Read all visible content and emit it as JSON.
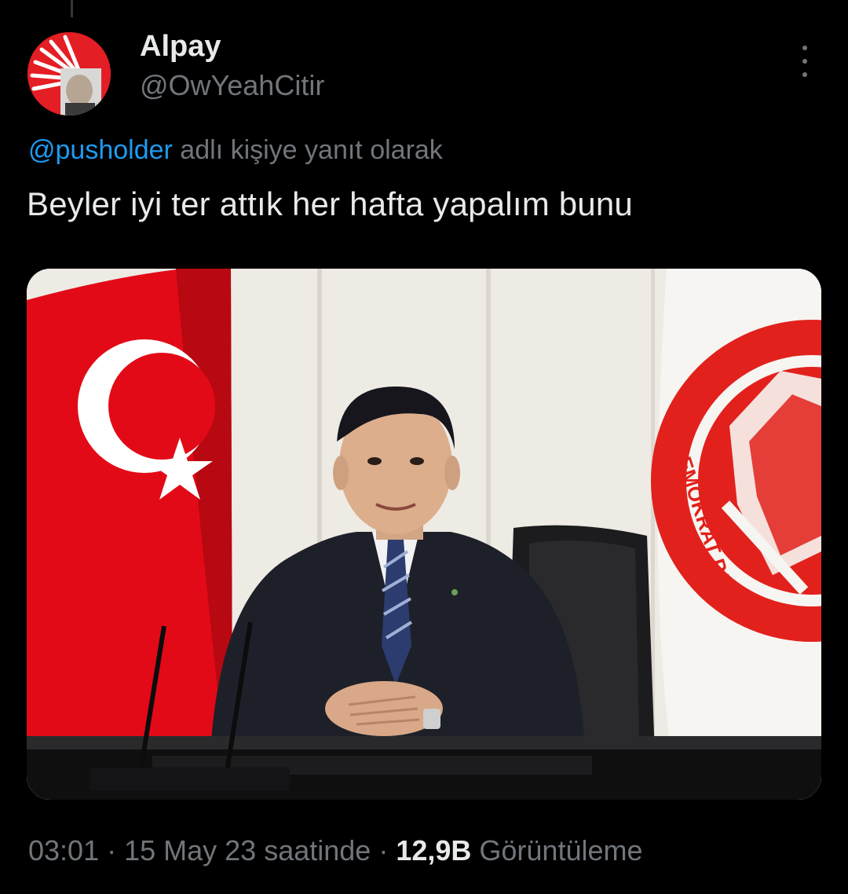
{
  "user": {
    "display_name": "Alpay",
    "handle": "@OwYeahCitir"
  },
  "reply_context": {
    "mention": "@pusholder",
    "text": " adlı kişiye yanıt olarak"
  },
  "tweet": {
    "text": "Beyler iyi ter attık her hafta yapalım bunu"
  },
  "media": {
    "logo_text": "DEMOKRAT PARTİ"
  },
  "meta": {
    "time": "03:01",
    "separator1": " · ",
    "date": "15 May 23 saatinde",
    "separator2": " · ",
    "views_count": "12,9B",
    "views_label": " Görüntüleme"
  },
  "icons": {
    "more": "more-vertical-icon"
  },
  "colors": {
    "background": "#000000",
    "text_primary": "#e7e9ea",
    "text_secondary": "#71767b",
    "link": "#1d9bf0",
    "flag_red": "#e30a17"
  }
}
